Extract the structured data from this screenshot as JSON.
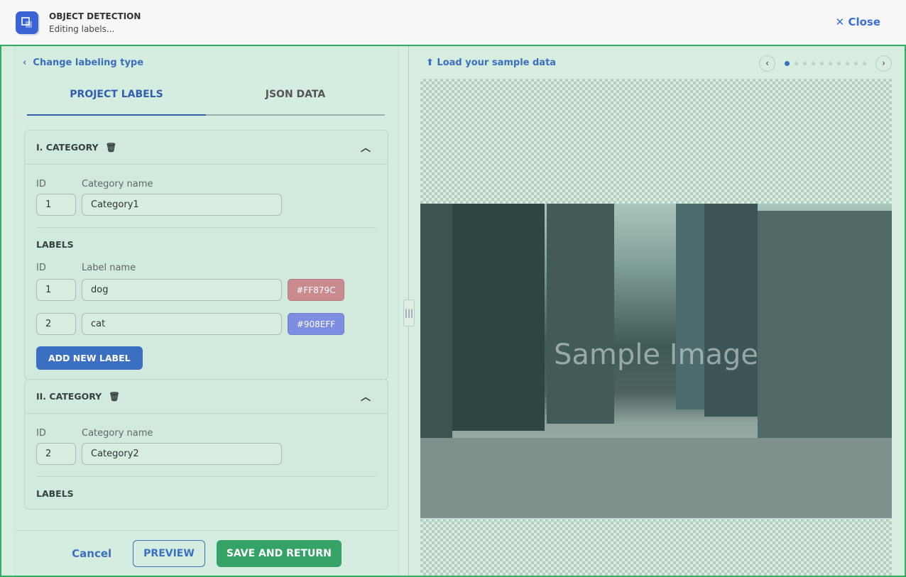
{
  "header": {
    "title": "OBJECT DETECTION",
    "subtitle": "Editing labels...",
    "close_label": "Close"
  },
  "left": {
    "back_label": "Change labeling type",
    "tabs": [
      {
        "label": "PROJECT LABELS",
        "active": true
      },
      {
        "label": "JSON DATA",
        "active": false
      }
    ],
    "categories": [
      {
        "title": "I. CATEGORY",
        "id_label": "ID",
        "name_label": "Category name",
        "id": "1",
        "name": "Category1",
        "labels_heading": "LABELS",
        "label_id_header": "ID",
        "label_name_header": "Label name",
        "labels": [
          {
            "id": "1",
            "name": "dog",
            "color": "#FF879C"
          },
          {
            "id": "2",
            "name": "cat",
            "color": "#908EFF"
          }
        ],
        "add_label": "ADD NEW LABEL"
      },
      {
        "title": "II. CATEGORY",
        "id_label": "ID",
        "name_label": "Category name",
        "id": "2",
        "name": "Category2",
        "labels_heading": "LABELS"
      }
    ],
    "footer": {
      "cancel": "Cancel",
      "preview": "PREVIEW",
      "save": "SAVE AND RETURN"
    }
  },
  "right": {
    "load_label": "Load your sample data",
    "pager": {
      "total": 10,
      "current": 1
    },
    "watermark": "Sample Image"
  },
  "colors": {
    "accent": "#3A6FC2",
    "save": "#35A266",
    "frame": "#2FAE5F"
  }
}
